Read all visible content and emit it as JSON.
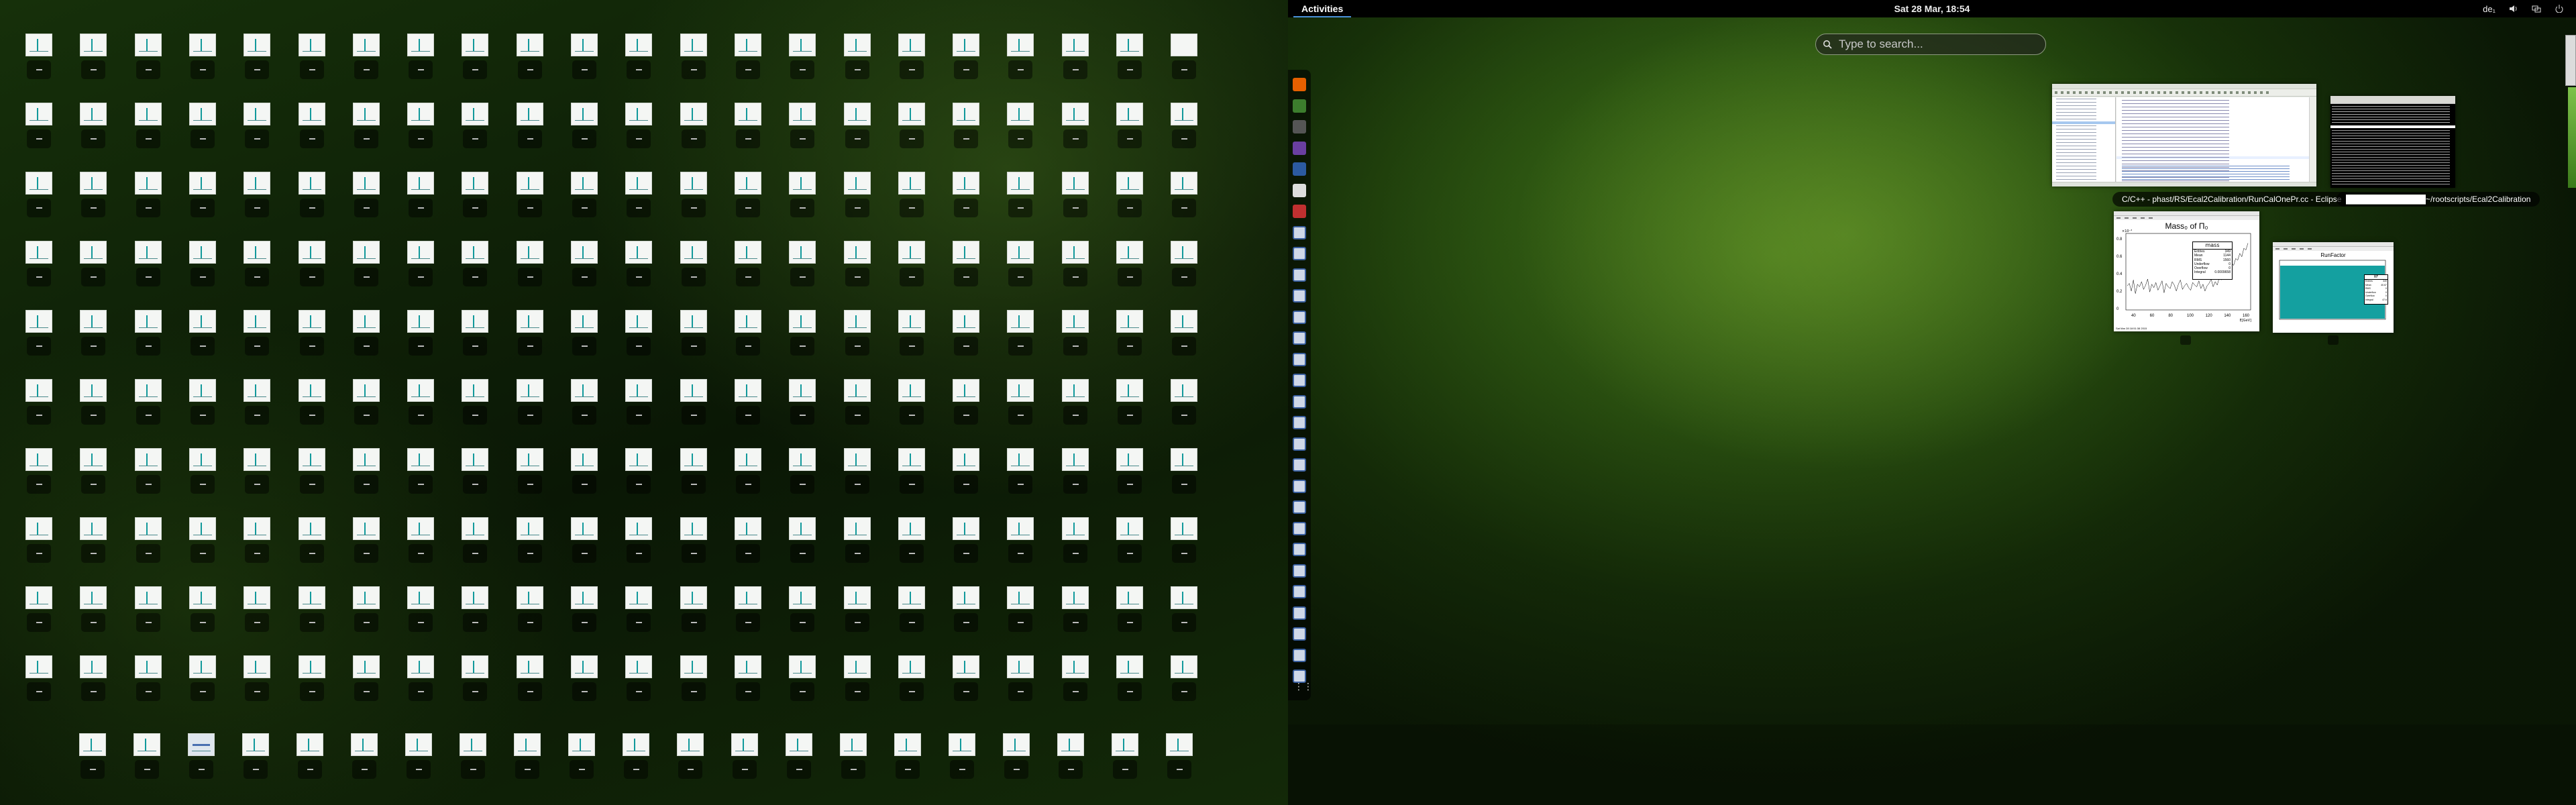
{
  "topbar": {
    "activities": "Activities",
    "clock": "Sat 28 Mar, 18:54",
    "input_method": "de₁",
    "icons": [
      "volume-icon",
      "network-icon",
      "power-icon"
    ]
  },
  "search": {
    "placeholder": "Type to search..."
  },
  "dash": {
    "icons": [
      "firefox-icon",
      "terminal-icon",
      "files-icon",
      "media-icon",
      "chat-icon",
      "document-icon",
      "software-icon",
      "app-icon",
      "app-icon",
      "app-icon",
      "app-icon",
      "app-icon",
      "app-icon",
      "app-icon",
      "app-icon",
      "app-icon",
      "app-icon",
      "app-icon",
      "app-icon",
      "app-icon",
      "app-icon",
      "app-icon",
      "app-icon",
      "app-icon",
      "app-icon",
      "app-icon",
      "app-icon",
      "app-icon",
      "app-icon"
    ],
    "show_apps_label": "⋮⋮"
  },
  "windows": {
    "eclipse": {
      "caption": "C/C++ - phast/RS/Ecal2Calibration/RunCalOnePr.cc - Eclipse"
    },
    "terminal": {
      "caption": "██████████████~/rootscripts/Ecal2Calibration"
    },
    "mass": {
      "title": "Mass₀ of Π₀",
      "y_scale": "×10⁻³",
      "stats": {
        "header": "mass",
        "rows": [
          {
            "k": "Entries",
            "v": "349"
          },
          {
            "k": "Mean",
            "v": "1144"
          },
          {
            "k": "RMS",
            "v": "1560"
          },
          {
            "k": "Underflow",
            "v": "0"
          },
          {
            "k": "Overflow",
            "v": "0"
          },
          {
            "k": "Integral",
            "v": "0.0009658"
          }
        ]
      },
      "y_ticks": [
        "0.8",
        "0.6",
        "0.4",
        "0.2",
        "0"
      ],
      "x_ticks": [
        "40",
        "60",
        "80",
        "100",
        "120",
        "140",
        "160"
      ],
      "x_unit": "E[GeV]",
      "date": "Sat Mar 28 18:51:38 2015",
      "series_values": [
        0.28,
        0.31,
        0.22,
        0.35,
        0.19,
        0.3,
        0.27,
        0.33,
        0.24,
        0.29,
        0.36,
        0.21,
        0.3,
        0.26,
        0.32,
        0.23,
        0.28,
        0.34,
        0.2,
        0.31,
        0.27,
        0.25,
        0.33,
        0.29,
        0.22,
        0.3,
        0.35,
        0.24,
        0.28,
        0.31,
        0.26,
        0.23,
        0.32,
        0.29,
        0.27,
        0.34,
        0.25,
        0.3,
        0.22,
        0.28,
        0.31,
        0.36,
        0.27,
        0.33,
        0.29,
        0.38,
        0.35,
        0.42,
        0.4,
        0.48,
        0.45,
        0.55,
        0.52,
        0.6,
        0.58,
        0.66,
        0.62,
        0.72,
        0.7,
        0.78
      ]
    },
    "runfactor": {
      "title": "RunFactor",
      "stats": {
        "header": "RF",
        "rows": [
          {
            "k": "Entries",
            "v": "349"
          },
          {
            "k": "Mean",
            "v": "40.67"
          },
          {
            "k": "RMS",
            "v": "0"
          },
          {
            "k": "Underflow",
            "v": "0"
          },
          {
            "k": "Overflow",
            "v": "0"
          },
          {
            "k": "Integral",
            "v": "47.6"
          }
        ]
      },
      "fill_color": "#14a0a0"
    }
  },
  "colors": {
    "accent": "#4a90d9",
    "teal": "#14a0a0"
  },
  "left_grid": {
    "cols": 22,
    "rows": 10,
    "bottom_cols": 21
  }
}
